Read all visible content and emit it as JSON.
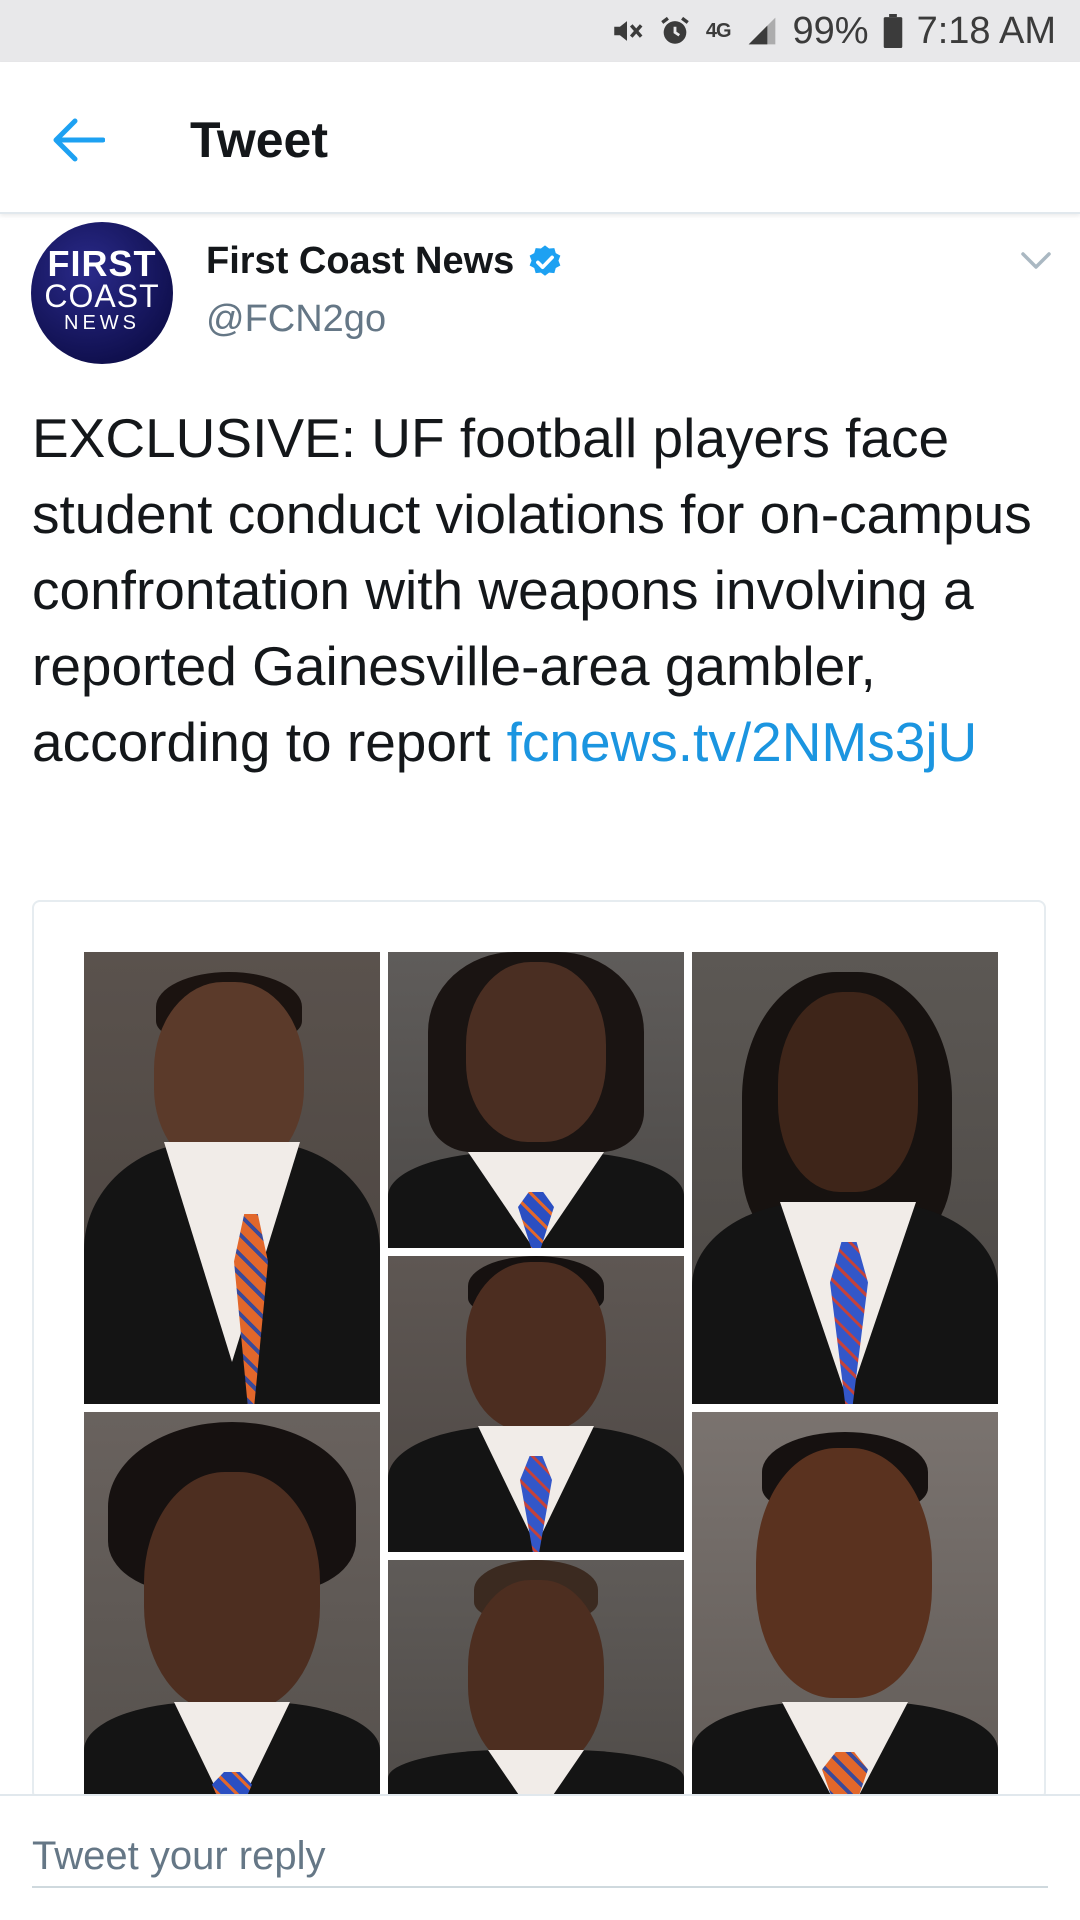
{
  "status_bar": {
    "network": "4G",
    "battery": "99%",
    "time": "7:18 AM",
    "icons": [
      "mute-icon",
      "alarm-icon",
      "signal-icon",
      "battery-icon"
    ]
  },
  "header": {
    "title": "Tweet",
    "back_icon": "back-arrow-icon",
    "accent_color": "#1da1f2"
  },
  "tweet": {
    "avatar": {
      "line1": "FIRST",
      "line2": "COAST",
      "line3": "NEWS"
    },
    "author_name": "First Coast News",
    "verified": true,
    "author_handle": "@FCN2go",
    "text": "EXCLUSIVE: UF football players face student conduct violations for on-campus confrontation with weapons involving a reported Gainesville-area gambler, according to report",
    "link": "fcnews.tv/2NMs3jU",
    "link_color": "#1b95e0",
    "media": {
      "photo_count": 7
    }
  },
  "reply": {
    "placeholder": "Tweet your reply"
  }
}
